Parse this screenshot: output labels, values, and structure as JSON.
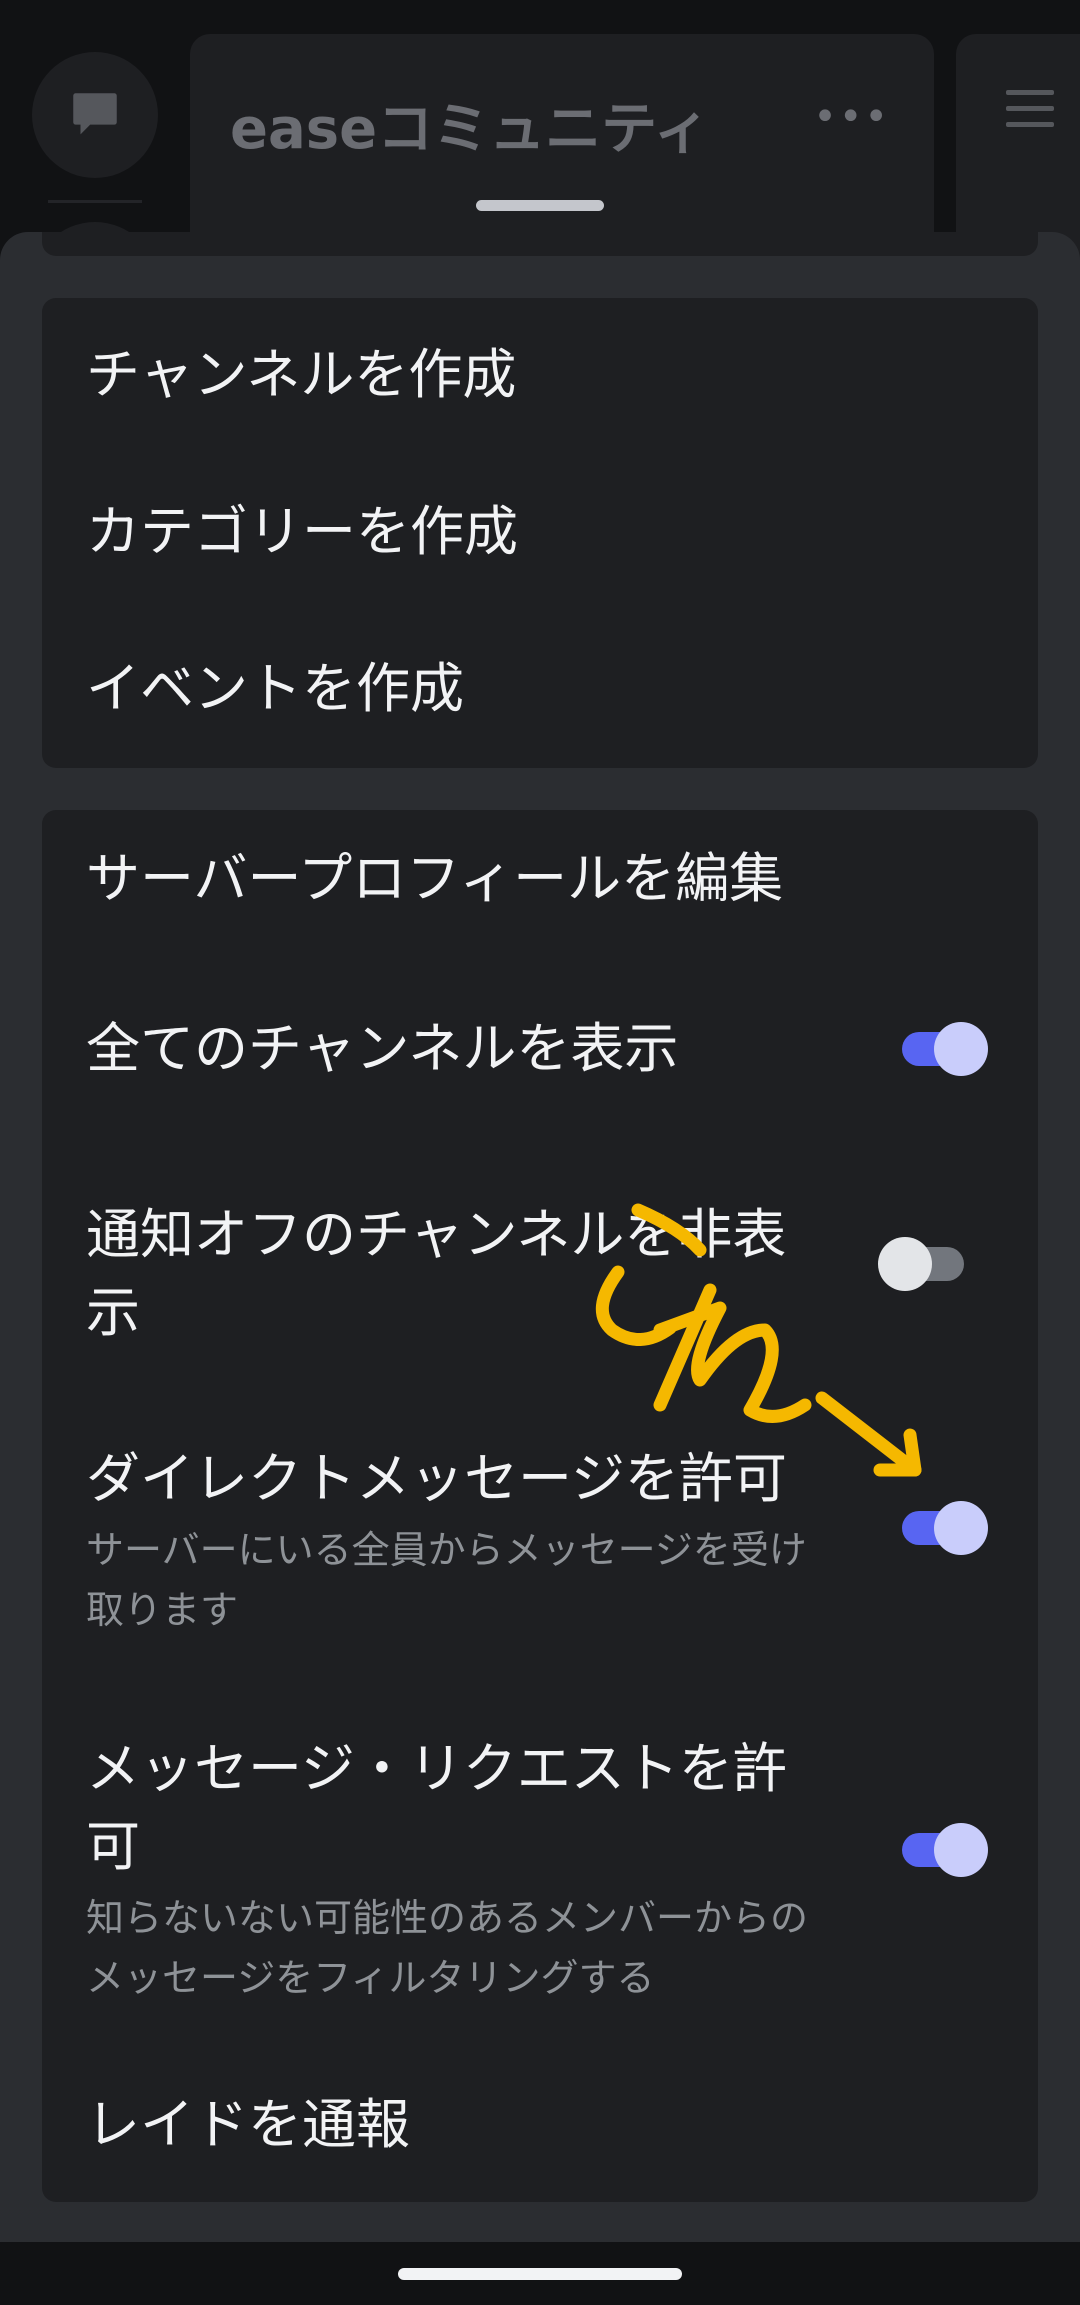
{
  "background": {
    "server_title": "easeコミュニティ",
    "more_label": "•••"
  },
  "menu_group_1": [
    {
      "label": "チャンネルを作成"
    },
    {
      "label": "カテゴリーを作成"
    },
    {
      "label": "イベントを作成"
    }
  ],
  "menu_group_2": {
    "edit_profile": {
      "label": "サーバープロフィールを編集"
    },
    "show_all_channels": {
      "label": "全てのチャンネルを表示",
      "enabled": true
    },
    "hide_muted": {
      "label": "通知オフのチャンネルを非表示",
      "enabled": false
    },
    "allow_dm": {
      "label": "ダイレクトメッセージを許可",
      "description": "サーバーにいる全員からメッセージを受け取ります",
      "enabled": true
    },
    "allow_requests": {
      "label": "メッセージ・リクエストを許可",
      "description": "知らないない可能性のあるメンバーからのメッセージをフィルタリングする",
      "enabled": true
    },
    "report_raid": {
      "label": "レイドを通報"
    }
  },
  "annotation": {
    "text": "これ",
    "color": "#f5b800"
  },
  "colors": {
    "toggle_on": "#5865f2",
    "toggle_off": "#72767d",
    "panel": "#1e1f22",
    "sheet": "#2b2d31"
  }
}
